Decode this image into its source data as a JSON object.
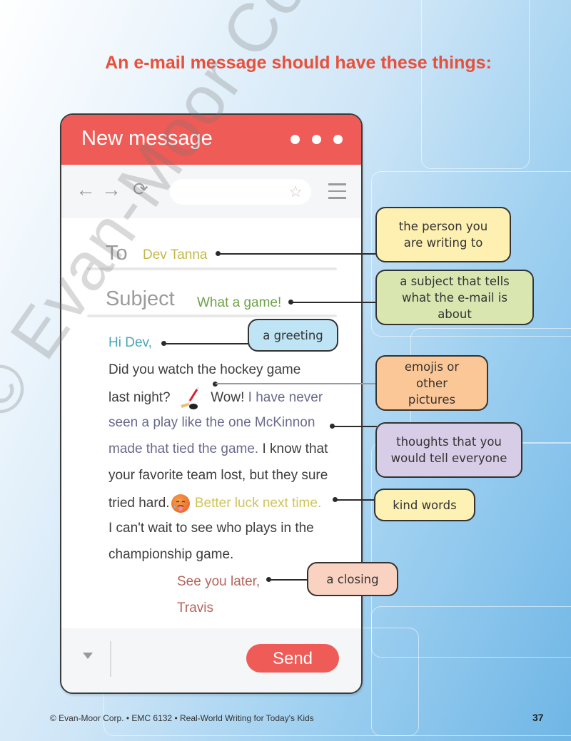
{
  "page": {
    "title": "An e-mail message should have these things:",
    "watermark": "© Evan-Moor Corporation.",
    "footer": "© Evan-Moor Corp. • EMC 6132 • Real-World Writing for Today's Kids",
    "page_number": "37"
  },
  "window": {
    "title": "New message",
    "window_controls": [
      "dot",
      "dot",
      "dot"
    ],
    "toolbar": {
      "back_icon": "←",
      "forward_icon": "→",
      "reload_icon": "⟳",
      "bookmark_icon": "☆",
      "menu_icon": "hamburger-menu",
      "url_value": ""
    },
    "to_label": "To",
    "to_value": "Dev Tanna",
    "subject_label": "Subject",
    "subject_value": "What a game!",
    "body": {
      "greeting": "Hi Dev,",
      "line1": "Did you watch the hockey game",
      "line2_a": "last night?",
      "line2_emoji": "hockey-stick-emoji",
      "line2_b": "Wow!",
      "line2_c": "I have never",
      "line3": "seen a play like the one McKinnon",
      "line4_a": "made that tied the game.",
      "line4_b": "I know that",
      "line5": "your favorite team lost, but they sure",
      "line6_a": "tried hard.",
      "line6_emoji": "hot-face-emoji",
      "line6_b": "Better luck next time.",
      "line7": "I can't wait to see who plays in the",
      "line8": "championship game.",
      "closing": "See you later,",
      "signature": "Travis"
    },
    "footer": {
      "options_icon": "▼",
      "send_label": "Send"
    }
  },
  "callouts": [
    {
      "id": "recipient",
      "text": "the person you are writing to",
      "color": "#fdf0b0"
    },
    {
      "id": "subject",
      "text": "a subject that tells what the e-mail is about",
      "color": "#d9e6b0"
    },
    {
      "id": "greeting",
      "text": "a greeting",
      "color": "#bfe4f6"
    },
    {
      "id": "emojis",
      "text": "emojis or other pictures",
      "color": "#fcc796"
    },
    {
      "id": "thoughts",
      "text": "thoughts that you would tell everyone",
      "color": "#d8cde6"
    },
    {
      "id": "kind-words",
      "text": "kind words",
      "color": "#fdf2b4"
    },
    {
      "id": "closing",
      "text": "a closing",
      "color": "#f9d2c2"
    }
  ],
  "colors": {
    "title": "#e8503a",
    "window_header": "#ef5b56",
    "send_button": "#ef5b56"
  }
}
